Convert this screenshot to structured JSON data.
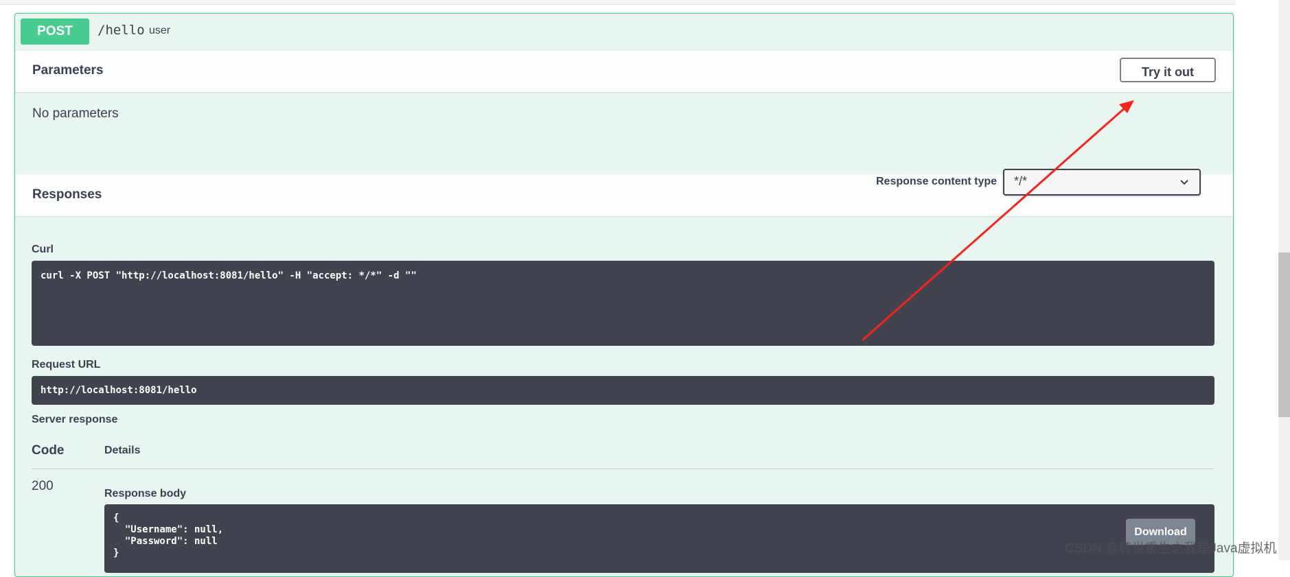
{
  "operation": {
    "method": "POST",
    "path": "/hello",
    "tag": "user"
  },
  "parameters": {
    "title": "Parameters",
    "try_button": "Try it out",
    "empty_text": "No parameters"
  },
  "responses": {
    "title": "Responses",
    "content_type_label": "Response content type",
    "content_type_value": "*/*"
  },
  "curl": {
    "label": "Curl",
    "command": "curl -X POST \"http://localhost:8081/hello\" -H \"accept: */*\" -d \"\""
  },
  "request_url": {
    "label": "Request URL",
    "value": "http://localhost:8081/hello"
  },
  "server_response": {
    "label": "Server response",
    "code_header": "Code",
    "details_header": "Details",
    "code": "200",
    "body_label": "Response body",
    "body": "{\n  \"Username\": null,\n  \"Password\": null\n}",
    "download_button": "Download"
  },
  "watermark": "CSDN @转世重生之我是Java虚拟机",
  "colors": {
    "post_green": "#49cc90",
    "opblock_bg": "#e8f6ef",
    "code_bg": "#41444e",
    "annotation_arrow": "#f5231c"
  },
  "icons": {
    "select_chevron": "chevron-down-icon",
    "annotation": "red-arrow-icon"
  }
}
